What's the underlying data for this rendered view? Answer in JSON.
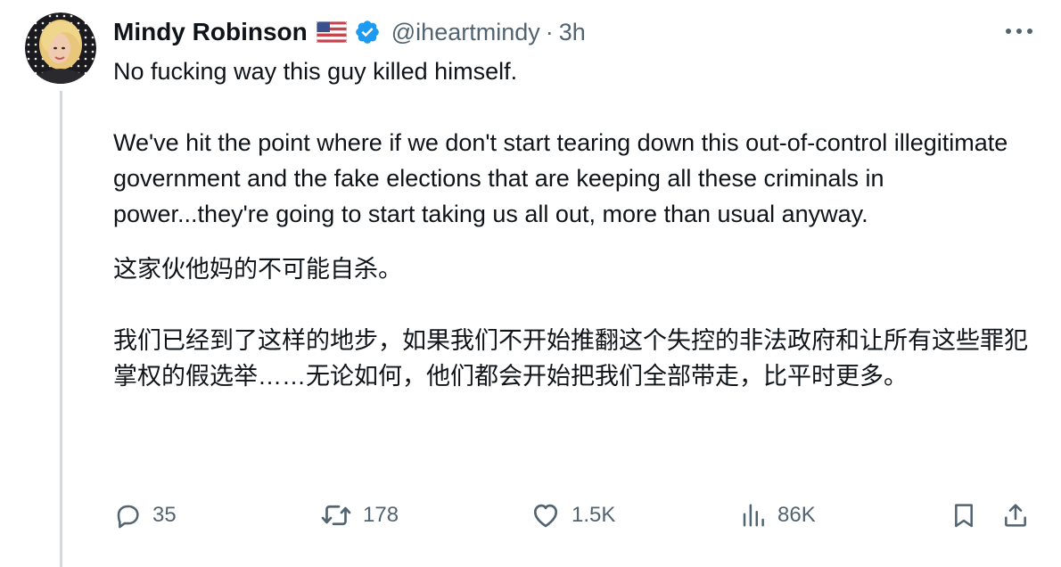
{
  "tweet": {
    "display_name": "Mindy Robinson",
    "handle": "@iheartmindy",
    "separator": "·",
    "time": "3h",
    "flag": "us-flag-icon",
    "verified": "verified-badge-icon",
    "paragraphs": {
      "en1": "No fucking way this guy killed himself.",
      "en2": "We've hit the point where if we don't start tearing down this out-of-control illegitimate government and the fake elections that are keeping all these criminals in power...they're going to start taking us all out, more than usual anyway.",
      "zh1": "这家伙他妈的不可能自杀。",
      "zh2": "我们已经到了这样的地步，如果我们不开始推翻这个失控的非法政府和让所有这些罪犯掌权的假选举……无论如何，他们都会开始把我们全部带走，比平时更多。"
    }
  },
  "actions": {
    "reply_count": "35",
    "retweet_count": "178",
    "like_count": "1.5K",
    "views_count": "86K"
  },
  "colors": {
    "text": "#0f1419",
    "secondary": "#536471",
    "verified": "#1d9bf0",
    "thread_line": "#cfd9de"
  }
}
